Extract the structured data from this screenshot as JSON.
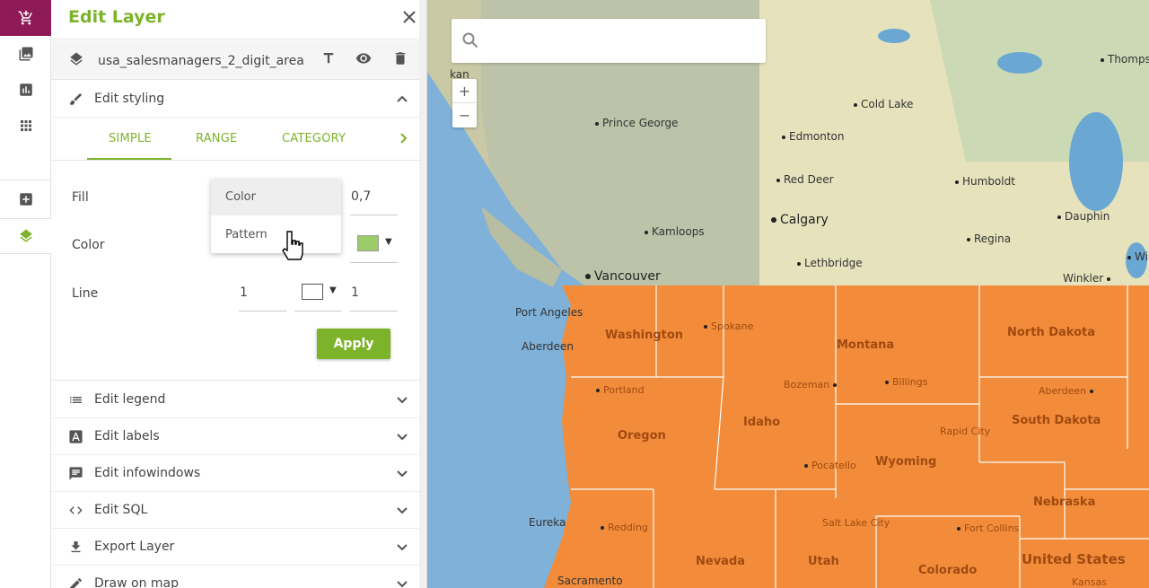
{
  "panel": {
    "title": "Edit Layer",
    "layer_name": "usa_salesmanagers_2_digit_area"
  },
  "sections": {
    "styling": "Edit styling",
    "legend": "Edit legend",
    "labels": "Edit labels",
    "infowindows": "Edit infowindows",
    "sql": "Edit SQL",
    "export": "Export Layer",
    "draw": "Draw on map"
  },
  "tabs": [
    "SIMPLE",
    "RANGE",
    "CATEGORY"
  ],
  "form": {
    "fill_label": "Fill",
    "fill_opacity": "0,7",
    "color_label": "Color",
    "color_value": "#9ccb6a",
    "line_label": "Line",
    "line_width": "1",
    "line_color": "#ffffff",
    "line_opacity": "1",
    "apply_label": "Apply"
  },
  "dropdown": {
    "options": [
      "Color",
      "Pattern"
    ],
    "selected": "Color"
  },
  "map": {
    "search_placeholder": "",
    "zoom_in": "+",
    "zoom_out": "−",
    "cities": [
      {
        "name": "Prince George"
      },
      {
        "name": "Cold Lake"
      },
      {
        "name": "Edmonton"
      },
      {
        "name": "Red Deer"
      },
      {
        "name": "Humboldt"
      },
      {
        "name": "Calgary"
      },
      {
        "name": "Kamloops"
      },
      {
        "name": "Dauphin"
      },
      {
        "name": "Regina"
      },
      {
        "name": "Lethbridge"
      },
      {
        "name": "Vancouver"
      },
      {
        "name": "Winkler"
      },
      {
        "name": "Port Angeles"
      },
      {
        "name": "Aberdeen"
      },
      {
        "name": "Spokane"
      },
      {
        "name": "Portland"
      },
      {
        "name": "Bozeman"
      },
      {
        "name": "Billings"
      },
      {
        "name": "Aberdeen"
      },
      {
        "name": "Rapid City"
      },
      {
        "name": "Pocatello"
      },
      {
        "name": "Eureka"
      },
      {
        "name": "Redding"
      },
      {
        "name": "Salt Lake City"
      },
      {
        "name": "Fort Collins"
      },
      {
        "name": "Sacramento"
      },
      {
        "name": "Kansas"
      },
      {
        "name": "Thomps"
      },
      {
        "name": "Winn"
      },
      {
        "name": "kan"
      }
    ],
    "states": [
      "Washington",
      "Montana",
      "North Dakota",
      "Idaho",
      "Oregon",
      "South Dakota",
      "Wyoming",
      "Nebraska",
      "Nevada",
      "Utah",
      "Colorado",
      "United States"
    ]
  },
  "colors": {
    "accent": "#7cb32b",
    "brand": "#8e1a57",
    "region_fill": "#f28c3a"
  }
}
